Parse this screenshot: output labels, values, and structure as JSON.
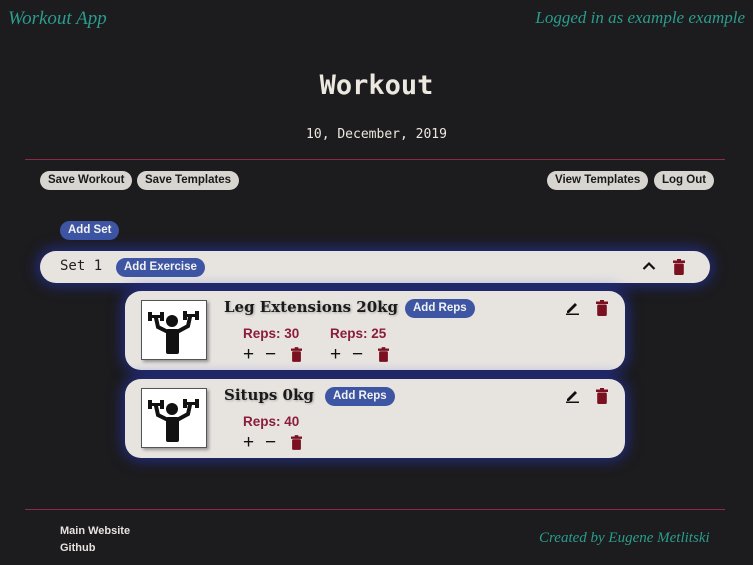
{
  "header": {
    "app_name": "Workout App",
    "login_status": "Logged in as example example"
  },
  "page": {
    "title": "Workout",
    "date": "10, December, 2019"
  },
  "toolbar": {
    "save_workout": "Save Workout",
    "save_templates": "Save Templates",
    "view_templates": "View Templates",
    "log_out": "Log Out"
  },
  "add_set_label": "Add Set",
  "sets": [
    {
      "label": "Set 1",
      "add_exercise_label": "Add Exercise",
      "exercises": [
        {
          "name": "Leg Extensions 20kg",
          "add_reps_label": "Add Reps",
          "reps": [
            "Reps: 30",
            "Reps: 25"
          ]
        },
        {
          "name": "Situps 0kg",
          "add_reps_label": "Add Reps",
          "reps": [
            "Reps: 40"
          ]
        }
      ]
    }
  ],
  "footer": {
    "main_website": "Main Website",
    "github": "Github",
    "credit": "Created by Eugene Metlitski"
  },
  "colors": {
    "background": "#1c1b1d",
    "accent_teal": "#2a9d8f",
    "divider": "#8e2a45",
    "button_blue": "#3d55a3",
    "reps_text": "#8b1c3a",
    "trash": "#7a1020"
  }
}
